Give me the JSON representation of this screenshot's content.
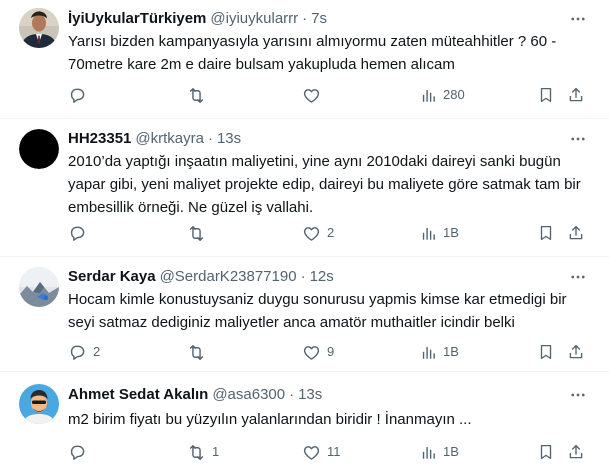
{
  "theme": {
    "text_color": "#0f1419",
    "muted_color": "#536471",
    "divider_color": "#eff3f4",
    "background": "#ffffff"
  },
  "tweets": [
    {
      "name": "İyiUykularTürkiyem",
      "handle": "@iyiuykularrr",
      "separator": "·",
      "time": "7s",
      "text": "Yarısı bizden kampanyasıyla yarısını almıyormu zaten müteahhitler ? 60 - 70metre kare 2m e daire bulsam yakupluda hemen alıcam",
      "actions": {
        "reply_count": "",
        "repost_count": "",
        "like_count": "",
        "views_count": "280"
      },
      "avatar_icon": "profile-photo-man-suit"
    },
    {
      "name": "HH23351",
      "handle": "@krtkayra",
      "separator": "·",
      "time": "13s",
      "text": "2010’da yaptığı inşaatın maliyetini, yine aynı 2010daki daireyi sanki bugün yapar gibi, yeni maliyet projekte edip, daireyi bu maliyete göre satmak tam bir embesillik örneği. Ne güzel iş vallahi.",
      "actions": {
        "reply_count": "",
        "repost_count": "",
        "like_count": "2",
        "views_count": "1B"
      },
      "avatar_icon": "profile-photo-black"
    },
    {
      "name": "Serdar Kaya",
      "handle": "@SerdarK23877190",
      "separator": "·",
      "time": "12s",
      "text": "Hocam kimle konustuysaniz duygu sonurusu yapmis kimse kar etmedigi bir seyi satmaz dediginiz maliyetler anca amatör muthaitler icindir belki",
      "actions": {
        "reply_count": "2",
        "repost_count": "",
        "like_count": "9",
        "views_count": "1B"
      },
      "avatar_icon": "profile-photo-landscape"
    },
    {
      "name": "Ahmet Sedat Akalın",
      "handle": "@asa6300",
      "separator": "·",
      "time": "13s",
      "text": "m2 birim fiyatı bu yüzyılın yalanlarından biridir ! İnanmayın ...",
      "actions": {
        "reply_count": "",
        "repost_count": "1",
        "like_count": "11",
        "views_count": "1B"
      },
      "avatar_icon": "profile-photo-cartoon"
    }
  ]
}
